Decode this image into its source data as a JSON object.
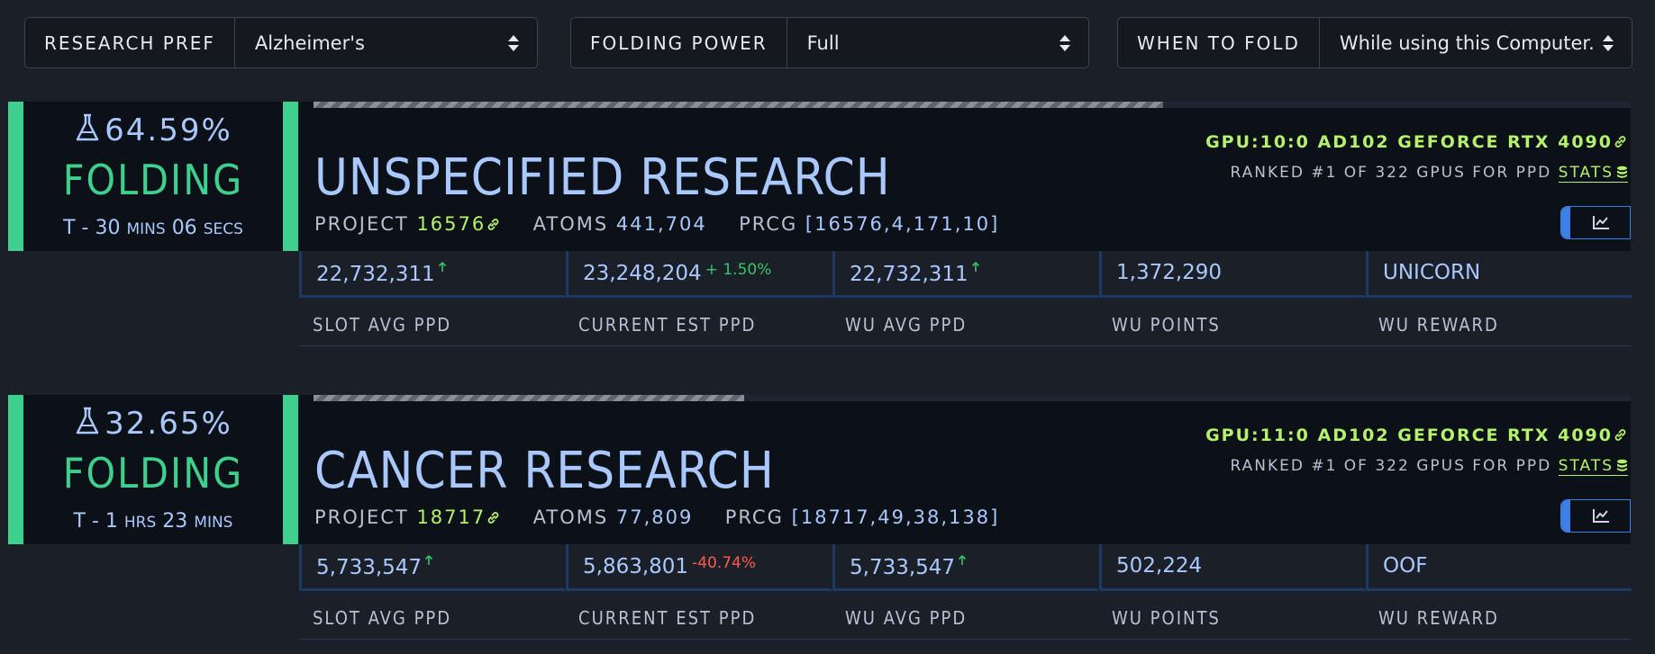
{
  "controls": {
    "research": {
      "label": "RESEARCH PREF",
      "value": "Alzheimer's"
    },
    "power": {
      "label": "FOLDING POWER",
      "value": "Full"
    },
    "when": {
      "label": "WHEN TO FOLD",
      "value": "While using this Computer."
    }
  },
  "icons": {
    "flask": "flask-icon",
    "link": "link-icon",
    "database": "database-icon",
    "chart": "line-chart-icon",
    "arrow_up": "arrow-up-icon"
  },
  "colors": {
    "accent_green": "#3fcf8e",
    "lime": "#b3f26a",
    "blue_text": "#a9c8ff",
    "link_blue": "#3d7fe6",
    "positive": "#35c566",
    "negative": "#ff5a4e"
  },
  "slots": [
    {
      "percent": "64.59%",
      "progress": 0.645,
      "state": "FOLDING",
      "eta": {
        "prefix": "T - ",
        "n1": "30",
        "u1": "MINS",
        "n2": "06",
        "u2": "SECS"
      },
      "title": "UNSPECIFIED RESEARCH",
      "project_label": "PROJECT",
      "project": "16576",
      "atoms_label": "ATOMS",
      "atoms": "441,704",
      "prcg_label": "PRCG",
      "prcg": "[16576,4,171,10]",
      "gpu": "GPU:10:0 AD102 GEFORCE RTX 4090",
      "ranked": "RANKED #1 OF 322 GPUS FOR PPD",
      "stats_link": "STATS",
      "slot_avg_ppd": "22,732,311",
      "current_est_ppd": "23,248,204",
      "change": "+ 1.50%",
      "change_dir": "up",
      "wu_avg_ppd": "22,732,311",
      "wu_points": "1,372,290",
      "wu_reward": "UNICORN"
    },
    {
      "percent": "32.65%",
      "progress": 0.327,
      "state": "FOLDING",
      "eta": {
        "prefix": "T - ",
        "n1": "1",
        "u1": "HRS",
        "n2": "23",
        "u2": "MINS"
      },
      "title": "CANCER RESEARCH",
      "project_label": "PROJECT",
      "project": "18717",
      "atoms_label": "ATOMS",
      "atoms": "77,809",
      "prcg_label": "PRCG",
      "prcg": "[18717,49,38,138]",
      "gpu": "GPU:11:0 AD102 GEFORCE RTX 4090",
      "ranked": "RANKED #1 OF 322 GPUS FOR PPD",
      "stats_link": "STATS",
      "slot_avg_ppd": "5,733,547",
      "current_est_ppd": "5,863,801",
      "change": "-40.74%",
      "change_dir": "down",
      "wu_avg_ppd": "5,733,547",
      "wu_points": "502,224",
      "wu_reward": "OOF"
    }
  ],
  "labels": {
    "slot_avg_ppd": "SLOT AVG PPD",
    "current_est_ppd": "CURRENT EST PPD",
    "wu_avg_ppd": "WU AVG PPD",
    "wu_points": "WU POINTS",
    "wu_reward": "WU REWARD"
  }
}
